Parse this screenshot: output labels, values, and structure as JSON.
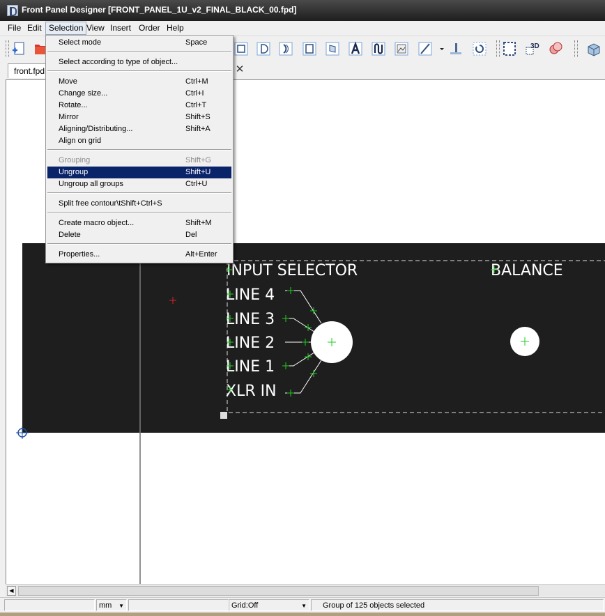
{
  "window": {
    "title": "Front Panel Designer [FRONT_PANEL_1U_v2_FINAL_BLACK_00.fpd]"
  },
  "menubar": [
    {
      "label": "File"
    },
    {
      "label": "Edit"
    },
    {
      "label": "Selection"
    },
    {
      "label": "View"
    },
    {
      "label": "Insert"
    },
    {
      "label": "Order"
    },
    {
      "label": "Help"
    }
  ],
  "tabs": [
    {
      "label": "front.fpd"
    }
  ],
  "selection_menu": {
    "items": [
      {
        "label": "Select mode",
        "shortcut": "Space"
      },
      {
        "label": "Select according to type of object...",
        "shortcut": ""
      },
      {
        "label": "Move",
        "shortcut": "Ctrl+M"
      },
      {
        "label": "Change size...",
        "shortcut": "Ctrl+I"
      },
      {
        "label": "Rotate...",
        "shortcut": "Ctrl+T"
      },
      {
        "label": "Mirror",
        "shortcut": "Shift+S"
      },
      {
        "label": "Aligning/Distributing...",
        "shortcut": "Shift+A"
      },
      {
        "label": "Align on grid",
        "shortcut": ""
      },
      {
        "label": "Grouping",
        "shortcut": "Shift+G",
        "state": "disabled"
      },
      {
        "label": "Ungroup",
        "shortcut": "Shift+U",
        "state": "highlighted"
      },
      {
        "label": "Ungroup all groups",
        "shortcut": "Ctrl+U"
      },
      {
        "label": "Split free contour\\tShift+Ctrl+S",
        "shortcut": ""
      },
      {
        "label": "Create macro object...",
        "shortcut": "Shift+M"
      },
      {
        "label": "Delete",
        "shortcut": "Del"
      },
      {
        "label": "Properties...",
        "shortcut": "Alt+Enter"
      }
    ]
  },
  "panel": {
    "color": "#1e1e1e",
    "labels": {
      "input_selector": "INPUT SELECTOR",
      "balance": "BALANCE",
      "line4": "LINE 4",
      "line3": "LINE 3",
      "line2": "LINE 2",
      "line1": "LINE 1",
      "xlr_in": "XLR IN"
    }
  },
  "statusbar": {
    "unit": "mm",
    "grid": "Grid:Off",
    "message": "Group of 125 objects selected"
  },
  "colors": {
    "menu_highlight": "#0a246a",
    "marker_green": "#22cc22",
    "marker_red": "#e02020"
  },
  "icons": [
    "new-document-icon",
    "open-folder-icon",
    "rectangle-icon",
    "d-shape-icon",
    "arc-icon",
    "square-cutout-icon",
    "slot-icon",
    "text-icon",
    "wave-icon",
    "image-icon",
    "line-icon",
    "pin-icon",
    "center-icon",
    "frame-icon",
    "3d-view-icon",
    "dimension-icon",
    "3d-box-icon"
  ]
}
